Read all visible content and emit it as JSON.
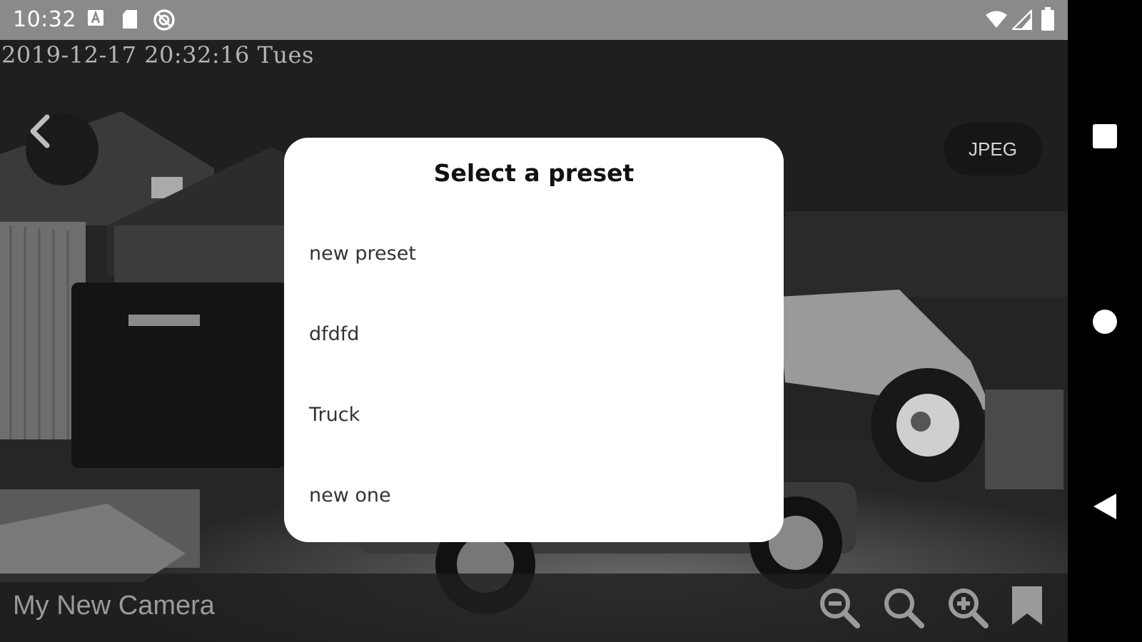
{
  "status_bar": {
    "time": "10:32",
    "left_icons": [
      "a-notification-icon",
      "sd-card-icon",
      "sync-off-icon"
    ],
    "right_icons": [
      "wifi-icon",
      "signal-icon",
      "battery-icon"
    ]
  },
  "camera": {
    "osd_timestamp": "2019-12-17 20:32:16 Tues",
    "format_button": "JPEG",
    "name": "My New Camera"
  },
  "toolbar": {
    "icons": [
      "zoom-out-icon",
      "zoom-reset-icon",
      "zoom-in-icon",
      "bookmark-icon"
    ]
  },
  "dialog": {
    "title": "Select a preset",
    "presets": [
      "new preset",
      "dfdfd",
      "Truck",
      "new one"
    ]
  },
  "navigation": {
    "buttons": [
      "recents-button",
      "home-button",
      "back-button"
    ]
  }
}
